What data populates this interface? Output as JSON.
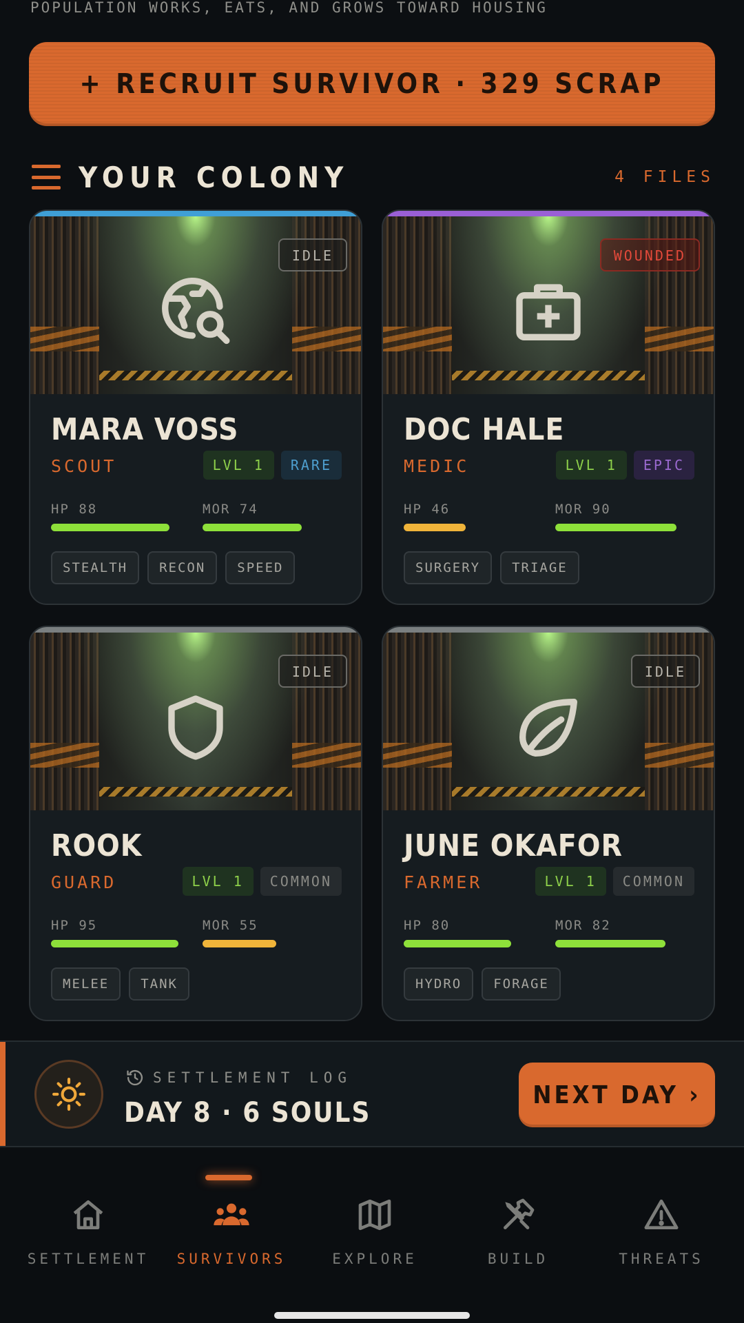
{
  "tagline": "POPULATION WORKS, EATS, AND GROWS TOWARD HOUSING",
  "recruit_button": "+ RECRUIT SURVIVOR · 329 SCRAP",
  "colony": {
    "title": "YOUR COLONY",
    "files": "4 FILES"
  },
  "survivors": [
    {
      "name": "MARA VOSS",
      "role": "SCOUT",
      "level": "LVL 1",
      "rarity": "RARE",
      "status": "IDLE",
      "hp_label": "HP 88",
      "hp": 88,
      "mor_label": "MOR 74",
      "mor": 74,
      "tags": [
        "STEALTH",
        "RECON",
        "SPEED"
      ],
      "icon": "globe-search-icon",
      "accent": "#3f9fd6"
    },
    {
      "name": "DOC HALE",
      "role": "MEDIC",
      "level": "LVL 1",
      "rarity": "EPIC",
      "status": "WOUNDED",
      "hp_label": "HP 46",
      "hp": 46,
      "mor_label": "MOR 90",
      "mor": 90,
      "tags": [
        "SURGERY",
        "TRIAGE"
      ],
      "icon": "medkit-icon",
      "accent": "#9a5fd6"
    },
    {
      "name": "ROOK",
      "role": "GUARD",
      "level": "LVL 1",
      "rarity": "COMMON",
      "status": "IDLE",
      "hp_label": "HP 95",
      "hp": 95,
      "mor_label": "MOR 55",
      "mor": 55,
      "tags": [
        "MELEE",
        "TANK"
      ],
      "icon": "shield-icon",
      "accent": "#7a7f80"
    },
    {
      "name": "JUNE OKAFOR",
      "role": "FARMER",
      "level": "LVL 1",
      "rarity": "COMMON",
      "status": "IDLE",
      "hp_label": "HP 80",
      "hp": 80,
      "mor_label": "MOR 82",
      "mor": 82,
      "tags": [
        "HYDRO",
        "FORAGE"
      ],
      "icon": "leaf-icon",
      "accent": "#7a7f80"
    }
  ],
  "settlement_log": {
    "label": "SETTLEMENT LOG",
    "value": "DAY 8 · 6 SOULS"
  },
  "next_day_button": "NEXT DAY ›",
  "nav": [
    {
      "label": "SETTLEMENT",
      "icon": "home-icon",
      "active": false
    },
    {
      "label": "SURVIVORS",
      "icon": "group-icon",
      "active": true
    },
    {
      "label": "EXPLORE",
      "icon": "map-icon",
      "active": false
    },
    {
      "label": "BUILD",
      "icon": "tools-icon",
      "active": false
    },
    {
      "label": "THREATS",
      "icon": "warning-icon",
      "active": false
    }
  ],
  "colors": {
    "accent": "#d9692e",
    "bar_good": "#8ee03a",
    "bar_warn": "#f0b43a",
    "background": "#0c0f12"
  }
}
